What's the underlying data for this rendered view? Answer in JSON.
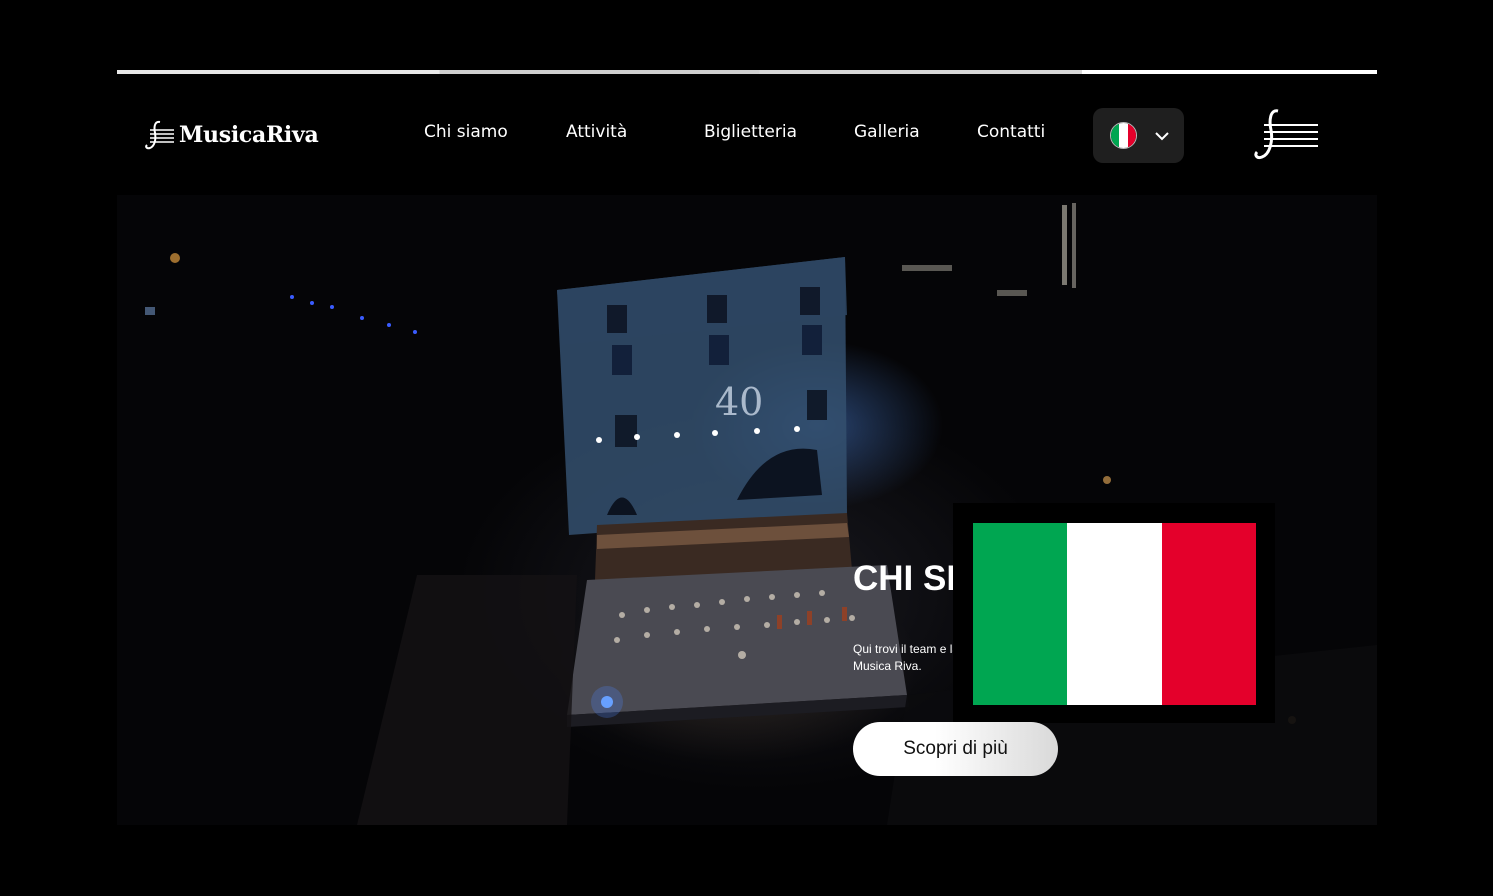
{
  "brand": {
    "name": "MusicaRiva"
  },
  "nav": {
    "items": [
      {
        "label": "Chi siamo"
      },
      {
        "label": "Attività"
      },
      {
        "label": "Biglietteria"
      },
      {
        "label": "Galleria"
      },
      {
        "label": "Contatti"
      }
    ]
  },
  "language": {
    "selected": "italian-flag-icon",
    "dropdown_icon": "chevron-down-icon"
  },
  "menu": {
    "icon": "hamburger-staff-icon"
  },
  "hero": {
    "title": "CHI SIAMO",
    "subtitle_line1": "Qui trovi il team e la storia di",
    "subtitle_line2": "Musica Riva.",
    "cta_label": "Scopri di più"
  },
  "flag_colors": {
    "green": "#00a651",
    "white": "#ffffff",
    "red": "#e4002b"
  }
}
